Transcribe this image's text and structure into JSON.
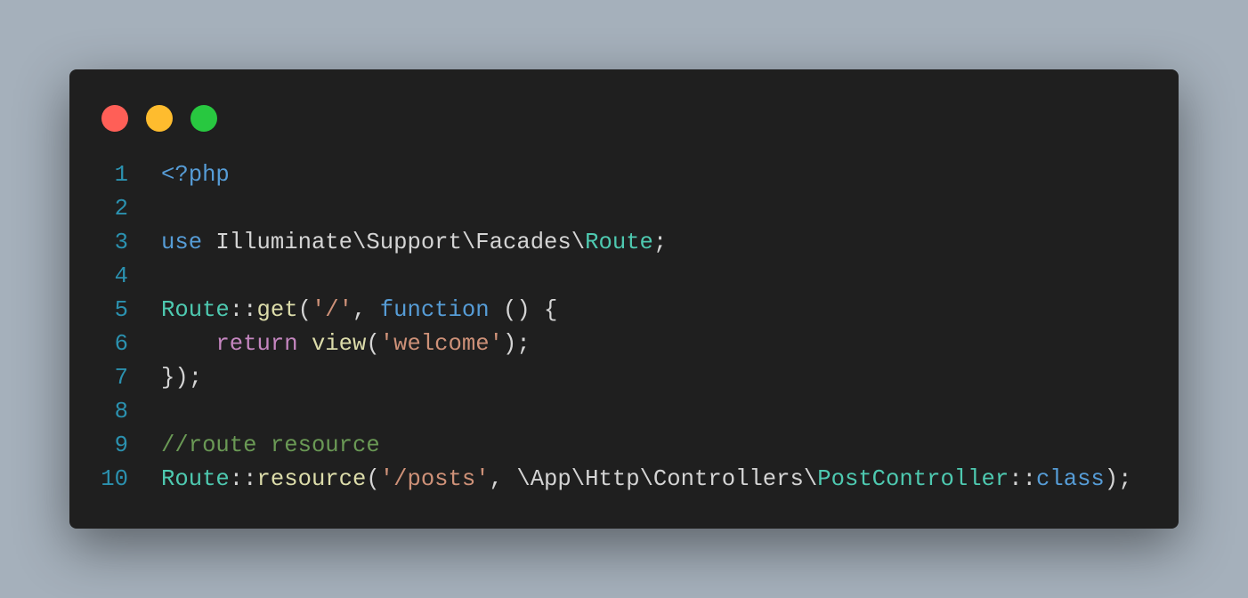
{
  "window": {
    "dots": [
      {
        "name": "close",
        "color": "#ff5f57"
      },
      {
        "name": "minimize",
        "color": "#febc2e"
      },
      {
        "name": "maximize",
        "color": "#28c840"
      }
    ]
  },
  "colors": {
    "kw": "#569cd6",
    "cls": "#4ec9b0",
    "fn": "#dcdcaa",
    "str": "#ce9178",
    "cmt": "#6a9955",
    "ctl": "#c586c0",
    "txt": "#d4d4d4"
  },
  "lines": [
    {
      "n": "1",
      "tokens": [
        {
          "t": "<?php",
          "c": "kw"
        }
      ]
    },
    {
      "n": "2",
      "tokens": []
    },
    {
      "n": "3",
      "tokens": [
        {
          "t": "use",
          "c": "kw"
        },
        {
          "t": " Illuminate\\Support\\Facades\\",
          "c": "txt"
        },
        {
          "t": "Route",
          "c": "cls"
        },
        {
          "t": ";",
          "c": "txt"
        }
      ]
    },
    {
      "n": "4",
      "tokens": []
    },
    {
      "n": "5",
      "tokens": [
        {
          "t": "Route",
          "c": "cls"
        },
        {
          "t": "::",
          "c": "txt"
        },
        {
          "t": "get",
          "c": "fn"
        },
        {
          "t": "(",
          "c": "txt"
        },
        {
          "t": "'/'",
          "c": "str"
        },
        {
          "t": ", ",
          "c": "txt"
        },
        {
          "t": "function",
          "c": "kw"
        },
        {
          "t": " () {",
          "c": "txt"
        }
      ]
    },
    {
      "n": "6",
      "tokens": [
        {
          "t": "    ",
          "c": "txt"
        },
        {
          "t": "return",
          "c": "ctl"
        },
        {
          "t": " ",
          "c": "txt"
        },
        {
          "t": "view",
          "c": "fn"
        },
        {
          "t": "(",
          "c": "txt"
        },
        {
          "t": "'welcome'",
          "c": "str"
        },
        {
          "t": ");",
          "c": "txt"
        }
      ]
    },
    {
      "n": "7",
      "tokens": [
        {
          "t": "});",
          "c": "txt"
        }
      ]
    },
    {
      "n": "8",
      "tokens": []
    },
    {
      "n": "9",
      "tokens": [
        {
          "t": "//route resource",
          "c": "cmt"
        }
      ]
    },
    {
      "n": "10",
      "tokens": [
        {
          "t": "Route",
          "c": "cls"
        },
        {
          "t": "::",
          "c": "txt"
        },
        {
          "t": "resource",
          "c": "fn"
        },
        {
          "t": "(",
          "c": "txt"
        },
        {
          "t": "'/posts'",
          "c": "str"
        },
        {
          "t": ", \\App\\Http\\Controllers\\",
          "c": "txt"
        },
        {
          "t": "PostController",
          "c": "cls"
        },
        {
          "t": "::",
          "c": "txt"
        },
        {
          "t": "class",
          "c": "kw"
        },
        {
          "t": ");",
          "c": "txt"
        }
      ]
    }
  ]
}
